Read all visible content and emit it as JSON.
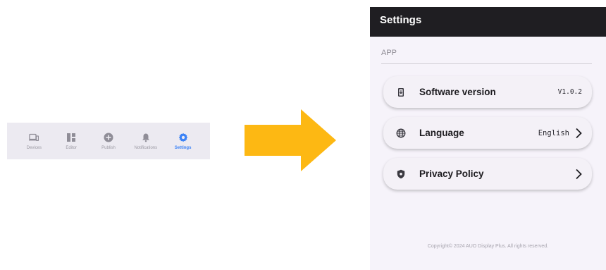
{
  "nav": {
    "items": [
      {
        "label": "Devices",
        "icon": "devices-icon",
        "active": false
      },
      {
        "label": "Editor",
        "icon": "editor-icon",
        "active": false
      },
      {
        "label": "Publish",
        "icon": "publish-icon",
        "active": false
      },
      {
        "label": "Notifications",
        "icon": "bell-icon",
        "active": false
      },
      {
        "label": "Settings",
        "icon": "gear-icon",
        "active": true
      }
    ]
  },
  "arrow_color": "#fdb813",
  "settings": {
    "title": "Settings",
    "section": "APP",
    "items": [
      {
        "label": "Software version",
        "value": "V1.0.2",
        "icon": "software-update-icon"
      },
      {
        "label": "Language",
        "value": "English",
        "icon": "globe-icon"
      },
      {
        "label": "Privacy Policy",
        "value": "",
        "icon": "shield-icon"
      }
    ],
    "copyright": "Copyright© 2024 AUO Display Plus. All rights reserved."
  },
  "colors": {
    "accent": "#3b82f6",
    "header_bg": "#1f1e22",
    "screen_bg": "#f6f3fa",
    "nav_bg": "#eceaf1"
  }
}
